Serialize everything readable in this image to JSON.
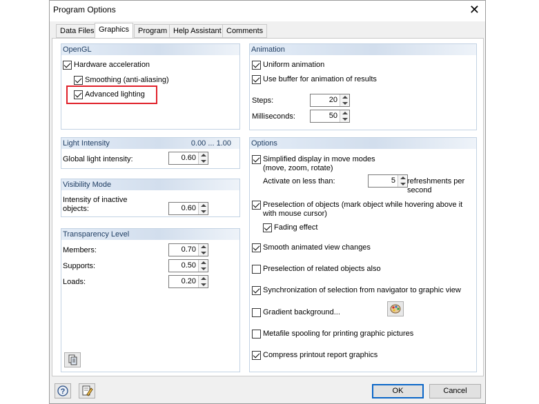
{
  "window": {
    "title": "Program Options"
  },
  "tabs": [
    "Data Files",
    "Graphics",
    "Program",
    "Help Assistant",
    "Comments"
  ],
  "opengl": {
    "header": "OpenGL",
    "hardware_acceleration": "Hardware acceleration",
    "smoothing": "Smoothing (anti-aliasing)",
    "advanced_lighting": "Advanced lighting"
  },
  "light_intensity": {
    "header": "Light Intensity",
    "range": "0.00 ... 1.00",
    "global_label": "Global light intensity:",
    "global_value": "0.60"
  },
  "visibility_mode": {
    "header": "Visibility Mode",
    "inactive_label_1": "Intensity of inactive",
    "inactive_label_2": "objects:",
    "inactive_value": "0.60"
  },
  "transparency": {
    "header": "Transparency Level",
    "members_label": "Members:",
    "members_value": "0.70",
    "supports_label": "Supports:",
    "supports_value": "0.50",
    "loads_label": "Loads:",
    "loads_value": "0.20"
  },
  "animation": {
    "header": "Animation",
    "uniform": "Uniform animation",
    "use_buffer": "Use buffer for animation of results",
    "steps_label": "Steps:",
    "steps_value": "20",
    "ms_label": "Milliseconds:",
    "ms_value": "50"
  },
  "options": {
    "header": "Options",
    "simplified_1": "Simplified display in move modes",
    "simplified_2": "(move, zoom, rotate)",
    "activate_label": "Activate on less than:",
    "activate_value": "5",
    "refresh_1": "refreshments per",
    "refresh_2": "second",
    "preselection_1": "Preselection of objects (mark object while hovering above it",
    "preselection_2": "with mouse cursor)",
    "fading": "Fading effect",
    "smooth": "Smooth animated view changes",
    "related": "Preselection of related objects also",
    "sync": "Synchronization of selection from navigator to graphic view",
    "gradient": "Gradient background...",
    "metafile": "Metafile spooling for printing graphic pictures",
    "compress": "Compress printout report graphics"
  },
  "buttons": {
    "ok": "OK",
    "cancel": "Cancel"
  },
  "icons": [
    "close-icon",
    "copy-icon",
    "help-icon",
    "edit-icon",
    "palette-icon"
  ]
}
